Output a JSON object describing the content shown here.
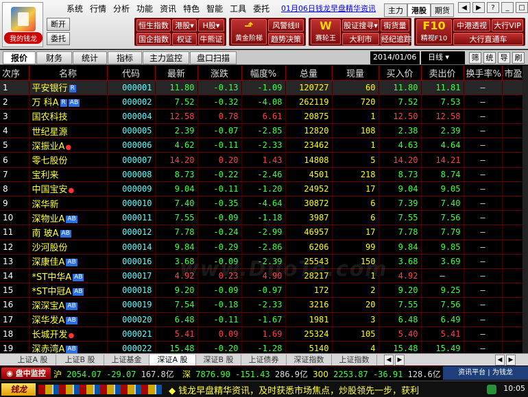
{
  "logo": {
    "label": "我的钱龙"
  },
  "menu": [
    "系统",
    "行情",
    "分析",
    "功能",
    "资讯",
    "特色",
    "智能",
    "工具",
    "委托"
  ],
  "news_link": "01月06日钱龙早盘精华资讯",
  "market_tabs": [
    {
      "label": "主力",
      "active": false
    },
    {
      "label": "港股",
      "active": true
    },
    {
      "label": "期货",
      "active": false
    }
  ],
  "side_buttons": [
    "断开",
    "委托"
  ],
  "toolbar": {
    "group1": [
      "恒生指数",
      "港股▾",
      "H股▾",
      "国企指数",
      "权证",
      "牛熊证"
    ],
    "group2": {
      "big1": "黄金阶梯",
      "small1": "风警线II",
      "small2": "趋势决策"
    },
    "group3": {
      "big1": "赛轮王",
      "small1": "股证搜寻▾",
      "small2": "大利市",
      "small3": "街货量",
      "small4": "经纪追踪"
    },
    "group4": {
      "big1": "精视F10",
      "small1": "中港透视",
      "small2": "大行VIP",
      "small3": "大行直通车"
    }
  },
  "subtabs": [
    {
      "label": "报价",
      "active": true
    },
    {
      "label": "财务",
      "active": false
    },
    {
      "label": "统计",
      "active": false
    },
    {
      "label": "指标",
      "active": false
    },
    {
      "label": "主力监控",
      "active": false
    },
    {
      "label": "盘口扫描",
      "active": false
    }
  ],
  "date": "2014/01/06",
  "period": "日线 ▾",
  "mini_buttons": [
    "筛",
    "统",
    "导",
    "刷"
  ],
  "columns": [
    "次序",
    "名称",
    "代码",
    "最新",
    "涨跌",
    "幅度%",
    "总量",
    "现量",
    "买入价",
    "卖出价",
    "换手率%",
    "市盈率"
  ],
  "rows": [
    {
      "idx": "1",
      "name": "平安银行",
      "badges": [
        "R"
      ],
      "dot": false,
      "code": "000001",
      "last": "11.80",
      "chg": "-0.13",
      "pct": "-1.09",
      "vol": "120727",
      "cur": "60",
      "bid": "11.80",
      "ask": "11.81",
      "turn": "—",
      "dir": "dn"
    },
    {
      "idx": "2",
      "name": "万  科A",
      "badges": [
        "R",
        "AB"
      ],
      "dot": false,
      "code": "000002",
      "last": "7.52",
      "chg": "-0.32",
      "pct": "-4.08",
      "vol": "262119",
      "cur": "720",
      "bid": "7.52",
      "ask": "7.53",
      "turn": "—",
      "dir": "dn"
    },
    {
      "idx": "3",
      "name": "国农科技",
      "badges": [],
      "dot": false,
      "code": "000004",
      "last": "12.58",
      "chg": "0.78",
      "pct": "6.61",
      "vol": "20875",
      "cur": "1",
      "bid": "12.50",
      "ask": "12.58",
      "turn": "—",
      "dir": "up"
    },
    {
      "idx": "4",
      "name": "世纪星源",
      "badges": [],
      "dot": false,
      "code": "000005",
      "last": "2.39",
      "chg": "-0.07",
      "pct": "-2.85",
      "vol": "12820",
      "cur": "108",
      "bid": "2.38",
      "ask": "2.39",
      "turn": "—",
      "dir": "dn"
    },
    {
      "idx": "5",
      "name": "深振业A",
      "badges": [],
      "dot": true,
      "code": "000006",
      "last": "4.62",
      "chg": "-0.11",
      "pct": "-2.33",
      "vol": "23462",
      "cur": "1",
      "bid": "4.63",
      "ask": "4.64",
      "turn": "—",
      "dir": "dn"
    },
    {
      "idx": "6",
      "name": "零七股份",
      "badges": [],
      "dot": false,
      "code": "000007",
      "last": "14.20",
      "chg": "0.20",
      "pct": "1.43",
      "vol": "14808",
      "cur": "5",
      "bid": "14.20",
      "ask": "14.21",
      "turn": "—",
      "dir": "up"
    },
    {
      "idx": "7",
      "name": "宝利来",
      "badges": [],
      "dot": false,
      "code": "000008",
      "last": "8.73",
      "chg": "-0.22",
      "pct": "-2.46",
      "vol": "4501",
      "cur": "218",
      "bid": "8.73",
      "ask": "8.74",
      "turn": "—",
      "dir": "dn"
    },
    {
      "idx": "8",
      "name": "中国宝安",
      "badges": [],
      "dot": true,
      "code": "000009",
      "last": "9.04",
      "chg": "-0.11",
      "pct": "-1.20",
      "vol": "24952",
      "cur": "17",
      "bid": "9.04",
      "ask": "9.05",
      "turn": "—",
      "dir": "dn"
    },
    {
      "idx": "9",
      "name": "深华新",
      "badges": [],
      "dot": false,
      "code": "000010",
      "last": "7.40",
      "chg": "-0.35",
      "pct": "-4.64",
      "vol": "30872",
      "cur": "6",
      "bid": "7.39",
      "ask": "7.40",
      "turn": "—",
      "dir": "dn"
    },
    {
      "idx": "10",
      "name": "深物业A",
      "badges": [
        "AB"
      ],
      "dot": false,
      "code": "000011",
      "last": "7.55",
      "chg": "-0.09",
      "pct": "-1.18",
      "vol": "3987",
      "cur": "6",
      "bid": "7.55",
      "ask": "7.56",
      "turn": "—",
      "dir": "dn"
    },
    {
      "idx": "11",
      "name": "南  玻A",
      "badges": [
        "AB"
      ],
      "dot": false,
      "code": "000012",
      "last": "7.78",
      "chg": "-0.24",
      "pct": "-2.99",
      "vol": "46957",
      "cur": "17",
      "bid": "7.78",
      "ask": "7.79",
      "turn": "—",
      "dir": "dn"
    },
    {
      "idx": "12",
      "name": "沙河股份",
      "badges": [],
      "dot": false,
      "code": "000014",
      "last": "9.84",
      "chg": "-0.29",
      "pct": "-2.86",
      "vol": "6206",
      "cur": "99",
      "bid": "9.84",
      "ask": "9.85",
      "turn": "—",
      "dir": "dn"
    },
    {
      "idx": "13",
      "name": "深康佳A",
      "badges": [
        "AB"
      ],
      "dot": false,
      "code": "000016",
      "last": "3.68",
      "chg": "-0.09",
      "pct": "-2.39",
      "vol": "25543",
      "cur": "150",
      "bid": "3.68",
      "ask": "3.69",
      "turn": "—",
      "dir": "dn"
    },
    {
      "idx": "14",
      "name": "*ST中华A",
      "badges": [
        "AB"
      ],
      "dot": false,
      "code": "000017",
      "last": "4.92",
      "chg": "0.23",
      "pct": "4.90",
      "vol": "28217",
      "cur": "1",
      "bid": "4.92",
      "ask": "—",
      "turn": "—",
      "dir": "up"
    },
    {
      "idx": "15",
      "name": "*ST中冠A",
      "badges": [
        "AB"
      ],
      "dot": false,
      "code": "000018",
      "last": "9.20",
      "chg": "-0.09",
      "pct": "-0.97",
      "vol": "172",
      "cur": "2",
      "bid": "9.20",
      "ask": "9.25",
      "turn": "—",
      "dir": "dn"
    },
    {
      "idx": "16",
      "name": "深深宝A",
      "badges": [
        "AB"
      ],
      "dot": false,
      "code": "000019",
      "last": "7.54",
      "chg": "-0.18",
      "pct": "-2.33",
      "vol": "3216",
      "cur": "20",
      "bid": "7.55",
      "ask": "7.56",
      "turn": "—",
      "dir": "dn"
    },
    {
      "idx": "17",
      "name": "深华发A",
      "badges": [
        "AB"
      ],
      "dot": false,
      "code": "000020",
      "last": "6.48",
      "chg": "-0.11",
      "pct": "-1.67",
      "vol": "1981",
      "cur": "3",
      "bid": "6.48",
      "ask": "6.49",
      "turn": "—",
      "dir": "dn"
    },
    {
      "idx": "18",
      "name": "长城开发",
      "badges": [],
      "dot": true,
      "code": "000021",
      "last": "5.41",
      "chg": "0.09",
      "pct": "1.69",
      "vol": "25324",
      "cur": "105",
      "bid": "5.40",
      "ask": "5.41",
      "turn": "—",
      "dir": "up"
    },
    {
      "idx": "19",
      "name": "深赤湾A",
      "badges": [
        "AB"
      ],
      "dot": false,
      "code": "000022",
      "last": "15.48",
      "chg": "-0.20",
      "pct": "-1.28",
      "vol": "5140",
      "cur": "4",
      "bid": "15.48",
      "ask": "15.49",
      "turn": "—",
      "dir": "dn"
    }
  ],
  "market_sheets": [
    {
      "label": "上证A 股",
      "active": false
    },
    {
      "label": "上证B 股",
      "active": false
    },
    {
      "label": "上证基金",
      "active": false
    },
    {
      "label": "深证A 股",
      "active": true
    },
    {
      "label": "深证B 股",
      "active": false
    },
    {
      "label": "上证债券",
      "active": false
    },
    {
      "label": "深证指数",
      "active": false
    },
    {
      "label": "上证指数",
      "active": false
    }
  ],
  "ticker": {
    "label": "◉ 盘中监控",
    "segments": [
      {
        "name": "沪",
        "price": "2054.07",
        "chg": "-29.07",
        "amount": "167.8亿"
      },
      {
        "name": "深",
        "price": "7876.90",
        "chg": "-151.43",
        "amount": "286.9亿"
      },
      {
        "name": "300",
        "price": "2253.87",
        "chg": "-36.91",
        "amount": "128.6亿"
      }
    ],
    "info": "资讯平台 | 为钱龙"
  },
  "bottom": {
    "brand": "钱龙",
    "scroll_text": "◆ 钱龙早盘精华资讯，及时获悉市场焦点，炒股领先一步，获利",
    "clock": "10:05"
  },
  "watermark": "www.DuoTe.com",
  "colors": {
    "up": "#ff4040",
    "down": "#40ff40",
    "name": "#ffff40",
    "code": "#55ffff",
    "grid_line": "#6a0000"
  }
}
